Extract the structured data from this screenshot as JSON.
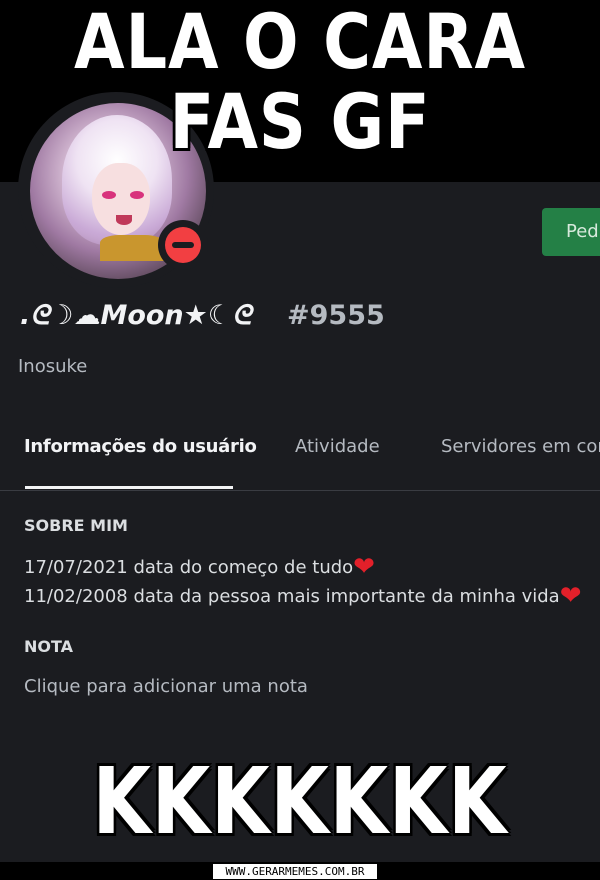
{
  "meme": {
    "top_line1": "ALA O CARA",
    "top_line2": "FAS GF",
    "bottom": "KKKKKKK"
  },
  "profile": {
    "username": ".ᘓ☽☁Moon★☾ᘓ",
    "discriminator": "#9555",
    "nickname": "Inosuke",
    "status": "do-not-disturb",
    "status_color": "#f23f42",
    "action_button_label": "Ped"
  },
  "tabs": [
    {
      "label": "Informações do usuário",
      "active": true
    },
    {
      "label": "Atividade",
      "active": false
    },
    {
      "label": "Servidores em cor",
      "active": false
    }
  ],
  "about": {
    "title": "SOBRE MIM",
    "lines": [
      {
        "text": "17/07/2021 data do começo de tudo",
        "emoji": "❤"
      },
      {
        "text": "11/02/2008 data da pessoa mais importante da minha vida",
        "emoji": "❤"
      }
    ]
  },
  "note": {
    "title": "NOTA",
    "placeholder": "Clique para adicionar uma nota"
  },
  "watermark": "WWW.GERARMEMES.COM.BR",
  "colors": {
    "background": "#1b1c20",
    "accent_green": "#248046",
    "heart": "#e3202a"
  }
}
